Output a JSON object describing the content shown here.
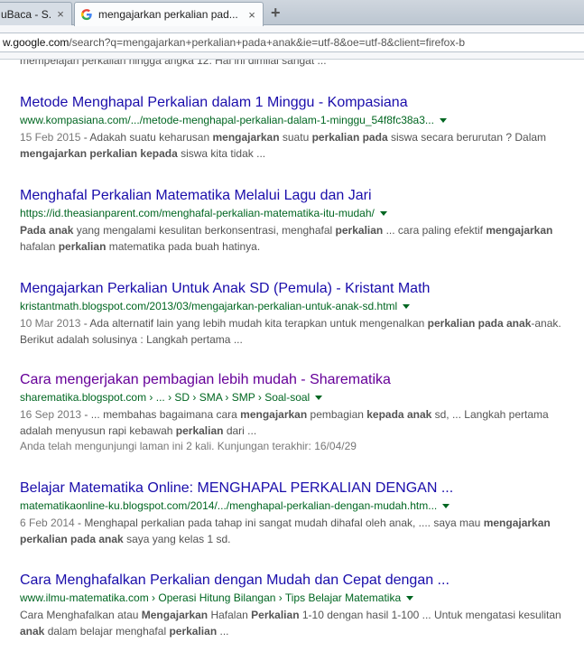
{
  "tabs": [
    {
      "label": "uBaca - S..."
    },
    {
      "label": "mengajarkan perkalian pad..."
    }
  ],
  "new_tab_symbol": "+",
  "close_symbol": "×",
  "url": {
    "prefix": "w.google.com",
    "path": "/search?q=mengajarkan+perkalian+pada+anak&ie=utf-8&oe=utf-8&client=firefox-b"
  },
  "cutoff_text": "mempelajari perkalian hingga angka 12. Hal ini dimilai sangat ...",
  "results": [
    {
      "title": "Metode Menghapal Perkalian dalam 1 Minggu - Kompasiana",
      "url": "www.kompasiana.com/.../metode-menghapal-perkalian-dalam-1-minggu_54f8fc38a3...",
      "snippet": [
        {
          "t": "15 Feb 2015",
          "d": true
        },
        {
          "t": " - Adakah suatu keharusan "
        },
        {
          "t": "mengajarkan",
          "b": true
        },
        {
          "t": " suatu "
        },
        {
          "t": "perkalian pada",
          "b": true
        },
        {
          "t": " siswa secara berurutan ? Dalam "
        },
        {
          "t": "mengajarkan perkalian kepada",
          "b": true
        },
        {
          "t": " siswa kita tidak ..."
        }
      ]
    },
    {
      "title": "Menghafal Perkalian Matematika Melalui Lagu dan Jari",
      "url": "https://id.theasianparent.com/menghafal-perkalian-matematika-itu-mudah/",
      "snippet": [
        {
          "t": "Pada anak",
          "b": true
        },
        {
          "t": " yang mengalami kesulitan berkonsentrasi, menghafal "
        },
        {
          "t": "perkalian",
          "b": true
        },
        {
          "t": " ... cara paling efektif "
        },
        {
          "t": "mengajarkan",
          "b": true
        },
        {
          "t": " hafalan "
        },
        {
          "t": "perkalian",
          "b": true
        },
        {
          "t": " matematika pada buah hatinya."
        }
      ]
    },
    {
      "title": "Mengajarkan Perkalian Untuk Anak SD (Pemula) - Kristant Math",
      "url": "kristantmath.blogspot.com/2013/03/mengajarkan-perkalian-untuk-anak-sd.html",
      "snippet": [
        {
          "t": "10 Mar 2013",
          "d": true
        },
        {
          "t": " - Ada alternatif lain yang lebih mudah kita terapkan untuk mengenalkan "
        },
        {
          "t": "perkalian pada anak",
          "b": true
        },
        {
          "t": "-anak. Berikut adalah solusinya : Langkah pertama ..."
        }
      ]
    },
    {
      "title": "Cara mengerjakan pembagian lebih mudah - Sharematika",
      "visited": true,
      "url": "sharematika.blogspot.com › ... › SD › SMA › SMP › Soal-soal",
      "snippet": [
        {
          "t": "16 Sep 2013",
          "d": true
        },
        {
          "t": " - ... membahas bagaimana cara "
        },
        {
          "t": "mengajarkan",
          "b": true
        },
        {
          "t": " pembagian "
        },
        {
          "t": "kepada anak",
          "b": true
        },
        {
          "t": " sd, ... Langkah pertama adalah menyusun rapi kebawah "
        },
        {
          "t": "perkalian",
          "b": true
        },
        {
          "t": " dari ..."
        }
      ],
      "visit_note": "Anda telah mengunjungi laman ini 2 kali. Kunjungan terakhir: 16/04/29"
    },
    {
      "title": "Belajar Matematika Online: MENGHAPAL PERKALIAN DENGAN ...",
      "url": "matematikaonline-ku.blogspot.com/2014/.../menghapal-perkalian-dengan-mudah.htm...",
      "snippet": [
        {
          "t": "6 Feb 2014",
          "d": true
        },
        {
          "t": " - Menghapal perkalian pada tahap ini sangat mudah dihafal oleh anak, .... saya mau "
        },
        {
          "t": "mengajarkan perkalian pada anak",
          "b": true
        },
        {
          "t": " saya yang kelas 1 sd."
        }
      ]
    },
    {
      "title": "Cara Menghafalkan Perkalian dengan Mudah dan Cepat dengan ...",
      "url": "www.ilmu-matematika.com › Operasi Hitung Bilangan › Tips Belajar Matematika",
      "snippet": [
        {
          "t": "Cara Menghafalkan atau "
        },
        {
          "t": "Mengajarkan",
          "b": true
        },
        {
          "t": " Hafalan "
        },
        {
          "t": "Perkalian",
          "b": true
        },
        {
          "t": " 1-10 dengan hasil 1-100 ... Untuk mengatasi kesulitan "
        },
        {
          "t": "anak",
          "b": true
        },
        {
          "t": " dalam belajar menghafal "
        },
        {
          "t": "perkalian",
          "b": true
        },
        {
          "t": " ..."
        }
      ]
    }
  ]
}
